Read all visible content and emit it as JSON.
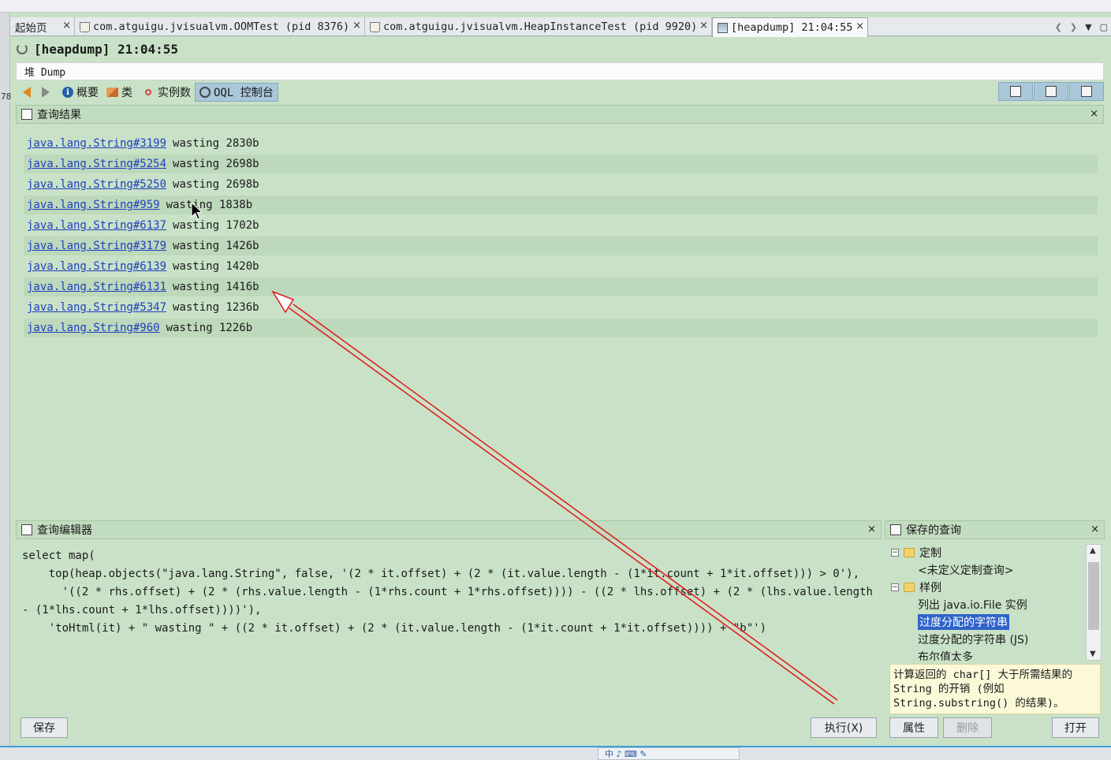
{
  "tabs": [
    {
      "label": "起始页"
    },
    {
      "label": "com.atguigu.jvisualvm.OOMTest (pid 8376)"
    },
    {
      "label": "com.atguigu.jvisualvm.HeapInstanceTest (pid 9920)"
    },
    {
      "label": "[heapdump] 21:04:55"
    }
  ],
  "tab_close_glyph": "×",
  "left_edge_text": "78",
  "title": "[heapdump] 21:04:55",
  "heap_label": "堆 Dump",
  "toolbar": {
    "summary": "概要",
    "classes": "类",
    "instances": "实例数",
    "oql": "OQL 控制台"
  },
  "results_panel": {
    "title": "查询结果",
    "close": "×",
    "rows": [
      {
        "link": "java.lang.String#3199",
        "text": "wasting 2830b"
      },
      {
        "link": "java.lang.String#5254",
        "text": "wasting 2698b"
      },
      {
        "link": "java.lang.String#5250",
        "text": "wasting 2698b"
      },
      {
        "link": "java.lang.String#959",
        "text": "wasting 1838b"
      },
      {
        "link": "java.lang.String#6137",
        "text": "wasting 1702b"
      },
      {
        "link": "java.lang.String#3179",
        "text": "wasting 1426b"
      },
      {
        "link": "java.lang.String#6139",
        "text": "wasting 1420b"
      },
      {
        "link": "java.lang.String#6131",
        "text": "wasting 1416b"
      },
      {
        "link": "java.lang.String#5347",
        "text": "wasting 1236b"
      },
      {
        "link": "java.lang.String#960",
        "text": "wasting 1226b"
      }
    ]
  },
  "editor": {
    "title": "查询编辑器",
    "close": "×",
    "query": "select map(\n    top(heap.objects(\"java.lang.String\", false, '(2 * it.offset) + (2 * (it.value.length - (1*it.count + 1*it.offset))) > 0'),\n      '((2 * rhs.offset) + (2 * (rhs.value.length - (1*rhs.count + 1*rhs.offset)))) - ((2 * lhs.offset) + (2 * (lhs.value.length - (1*lhs.count + 1*lhs.offset))))'),\n    'toHtml(it) + \" wasting \" + ((2 * it.offset) + (2 * (it.value.length - (1*it.count + 1*it.offset)))) + \"b\"')",
    "save": "保存",
    "execute": "执行(X)"
  },
  "saved_panel": {
    "title": "保存的查询",
    "close": "×",
    "tree": [
      {
        "label": "定制",
        "type": "folder"
      },
      {
        "label": "<未定义定制查询>",
        "type": "leaf"
      },
      {
        "label": "样例",
        "type": "folder"
      },
      {
        "label": "列出 java.io.File 实例",
        "type": "leaf"
      },
      {
        "label": "过度分配的字符串",
        "type": "leaf",
        "selected": true
      },
      {
        "label": "过度分配的字符串 (JS)",
        "type": "leaf"
      },
      {
        "label": "布尔值太多",
        "type": "leaf"
      }
    ],
    "description": "计算返回的 char[] 大于所需结果的\nString 的开销 (例如\nString.substring() 的结果)。",
    "properties": "属性",
    "delete": "删除",
    "open": "打开"
  },
  "ime": "中 ♪ ⌨ ✎",
  "colors": {
    "background": "#c9e2c7",
    "link": "#1f3fbf",
    "annotation_arrow": "#e02020",
    "selection": "#2e63c9"
  }
}
